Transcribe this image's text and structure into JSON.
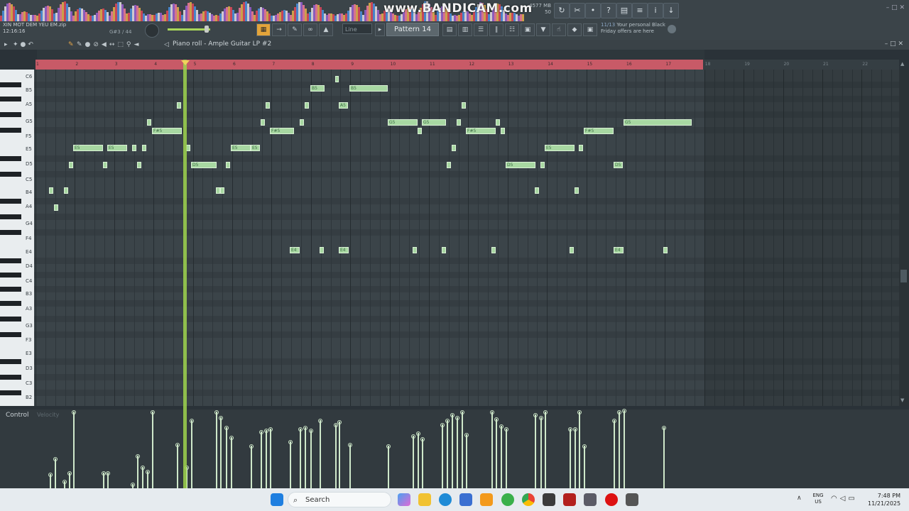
{
  "top": {
    "watermark": "www.BANDICAM.com",
    "memory": [
      "4577 MB",
      "50"
    ],
    "project_file": "XIN MOT DEM YEU EM.zip",
    "time": "12:16:16",
    "step_readout": "G#3 / 44",
    "snap_mode": "Line",
    "pattern": "Pattern 14",
    "promo_date": "11/13",
    "promo_text": "Your personal Black Friday offers are here"
  },
  "pianoroll": {
    "title": "Piano roll - Ample Guitar LP #2",
    "bars": [
      "1",
      "2",
      "3",
      "4",
      "5",
      "6",
      "7",
      "8",
      "9",
      "10",
      "11",
      "12",
      "13",
      "14",
      "15",
      "16",
      "17",
      "18",
      "19",
      "20",
      "21",
      "22"
    ],
    "key_labels": [
      "C6",
      "B5",
      "A5",
      "G5",
      "F5",
      "E5",
      "D5",
      "C5",
      "B4",
      "A4",
      "G4",
      "F4",
      "E4",
      "D4",
      "C4",
      "B3",
      "A3",
      "G3",
      "F3",
      "E3",
      "D3",
      "C3",
      "B2"
    ],
    "control_label": "Control",
    "control_target": "Velocity",
    "note_labels": {
      "B5a": "B5",
      "B5b": "B5",
      "A5": "A5",
      "G5a": "G5",
      "G5b": "G5",
      "G5c": "G5",
      "Fs5a": "F#5",
      "Fs5b": "F#5",
      "Fs5c": "F#5",
      "Fs5d": "F#5",
      "E5a": "E5",
      "E5b": "E5",
      "E5c": "E5",
      "E5d": "E5",
      "E5e": "E5",
      "D5a": "D5",
      "D5b": "D5",
      "D5c": "D5",
      "E4a": "E4",
      "E4b": "E4",
      "E4c": "E4"
    }
  },
  "taskbar": {
    "search": "Search",
    "lang": [
      "ENG",
      "US"
    ],
    "clock": "7:48 PM",
    "date": "11/21/2025"
  }
}
